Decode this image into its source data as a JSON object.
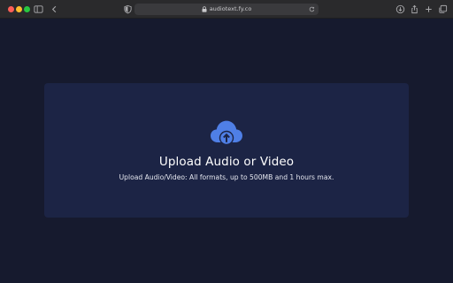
{
  "browser": {
    "url": "audiotext.fy.co"
  },
  "upload": {
    "title": "Upload Audio or Video",
    "subtitle": "Upload Audio/Video: All formats, up to 500MB and 1 hours max.",
    "icon": "cloud-upload-icon",
    "accent_color": "#4f7fe6"
  },
  "colors": {
    "page_background": "#161a2e",
    "card_background": "#1c2445"
  }
}
